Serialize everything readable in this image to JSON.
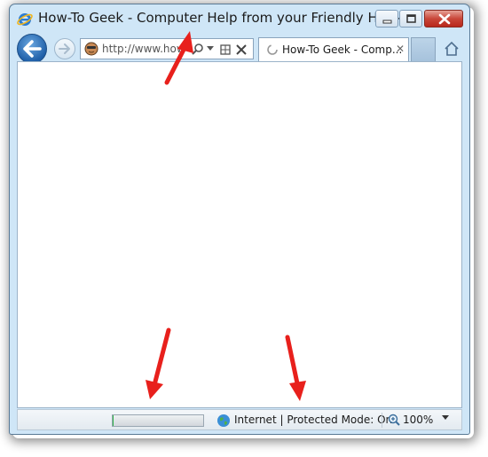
{
  "window": {
    "title": "How-To Geek - Computer Help from your Friendly How-T..."
  },
  "navigation": {
    "address_url": "http://www.how",
    "tab_label": "How-To Geek - Comp...",
    "tab_close": "✕"
  },
  "statusbar": {
    "progress_fraction": 0.01,
    "zone": "Internet | Protected Mode: On",
    "zoom": "100%"
  },
  "colors": {
    "window_frame": "#cfe6f7",
    "close_button": "#c9473a",
    "annotation_arrow": "#e8201c"
  },
  "icons": [
    "ie-logo-icon",
    "minimize-icon",
    "maximize-icon",
    "close-icon",
    "back-arrow-icon",
    "forward-arrow-icon",
    "site-favicon-icon",
    "search-icon",
    "compatibility-view-icon",
    "stop-icon",
    "loading-spinner-icon",
    "home-icon",
    "globe-icon",
    "zoom-icon",
    "chevron-down-icon"
  ]
}
